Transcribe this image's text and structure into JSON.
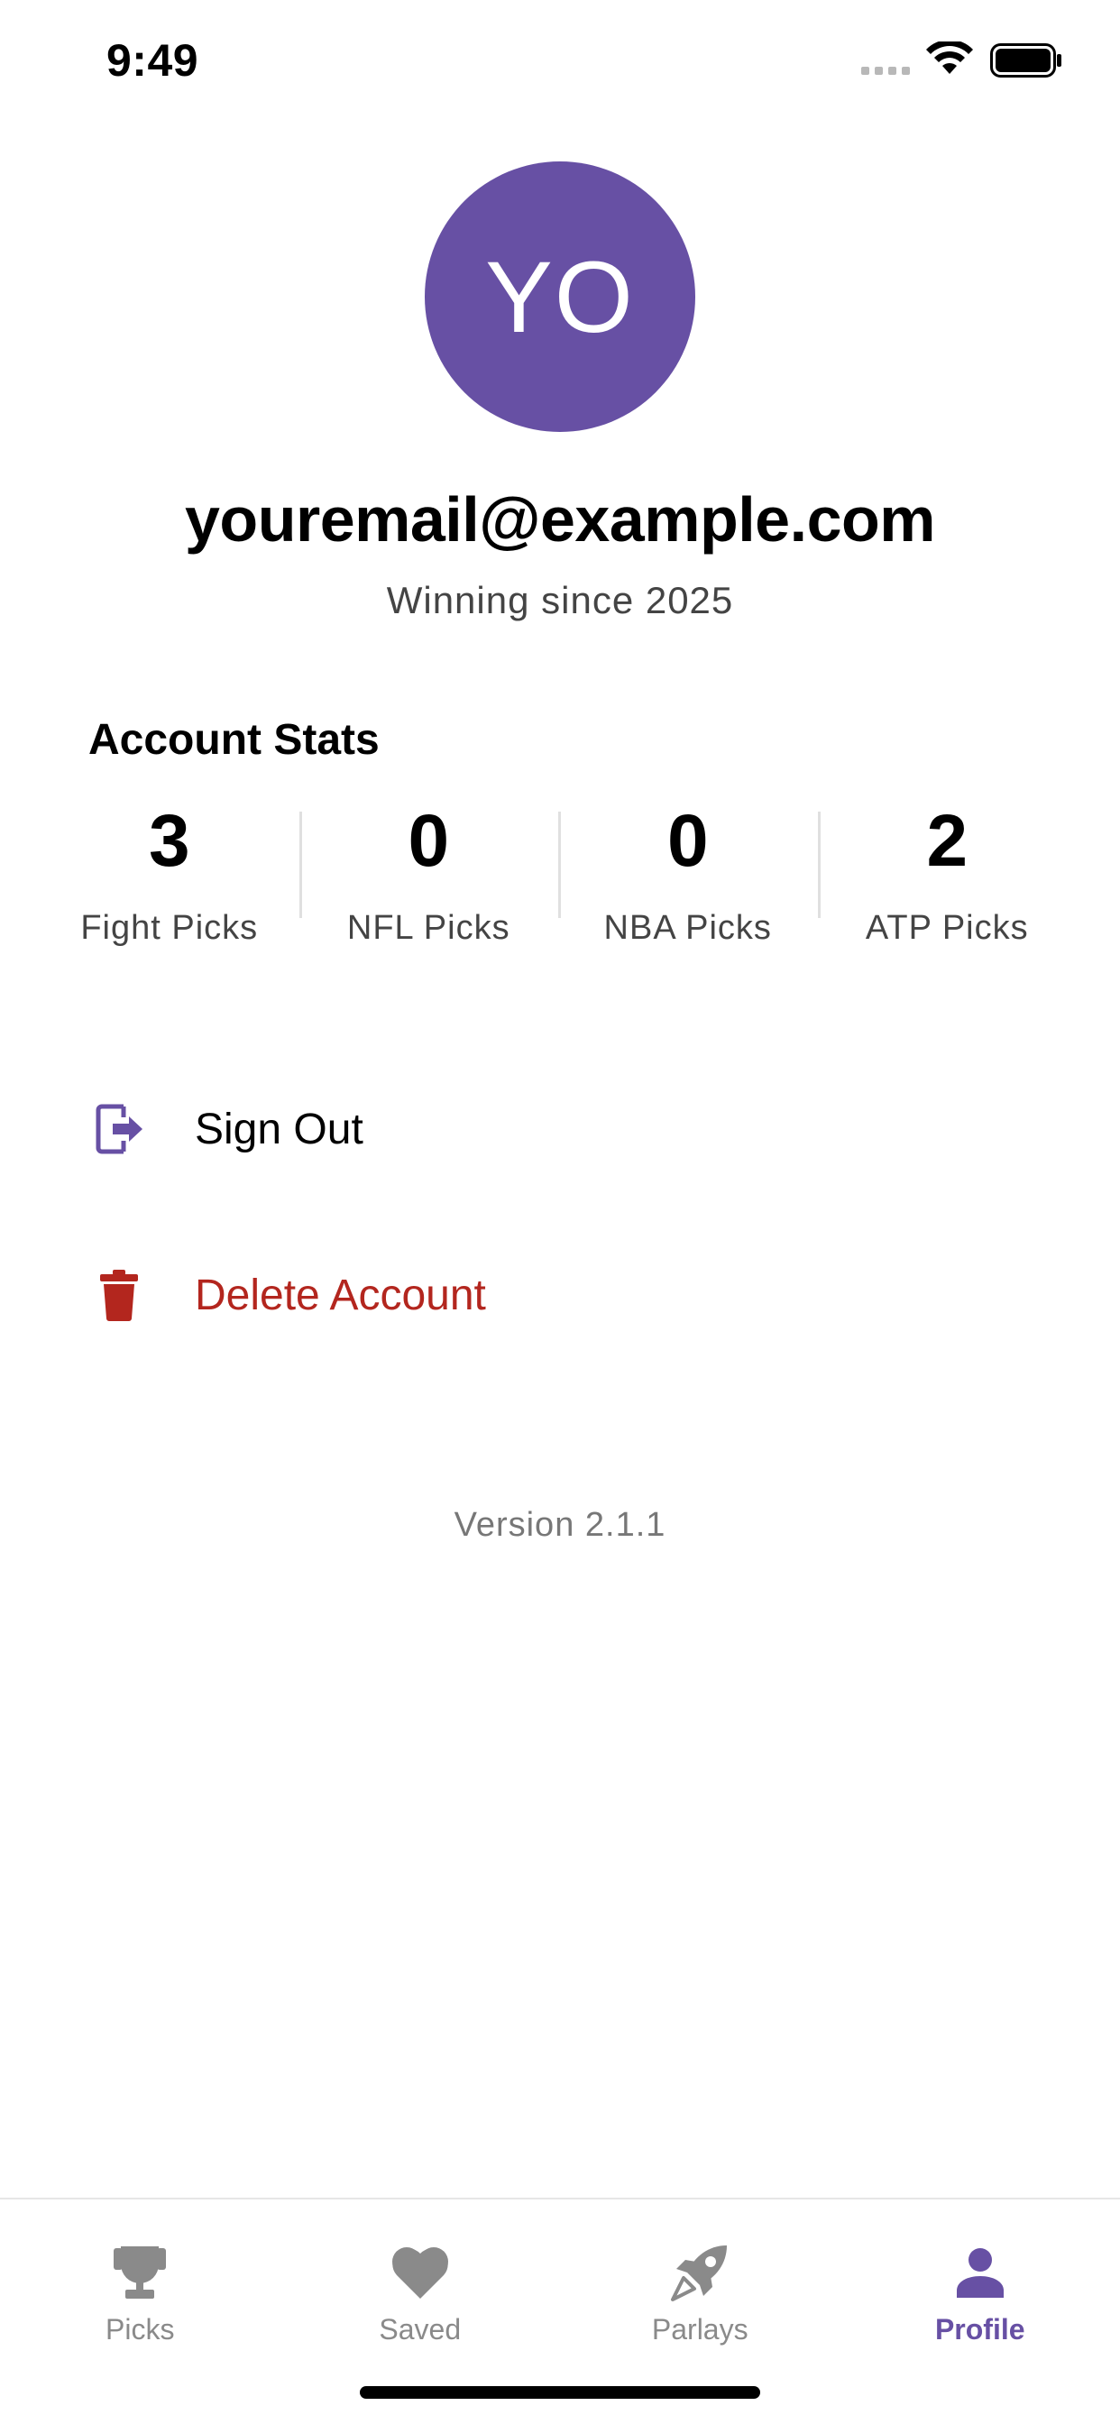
{
  "status_bar": {
    "time": "9:49"
  },
  "profile": {
    "initials": "YO",
    "email": "youremail@example.com",
    "subtitle": "Winning since 2025",
    "avatar_color": "#6750a4"
  },
  "stats": {
    "title": "Account Stats",
    "items": [
      {
        "value": "3",
        "label": "Fight Picks"
      },
      {
        "value": "0",
        "label": "NFL Picks"
      },
      {
        "value": "0",
        "label": "NBA Picks"
      },
      {
        "value": "2",
        "label": "ATP Picks"
      }
    ]
  },
  "menu": {
    "sign_out": {
      "label": "Sign Out",
      "icon": "logout-icon"
    },
    "delete_account": {
      "label": "Delete Account",
      "icon": "trash-icon",
      "color": "#b3261e"
    }
  },
  "version": "Version 2.1.1",
  "tabs": [
    {
      "label": "Picks",
      "icon": "trophy-icon",
      "active": false
    },
    {
      "label": "Saved",
      "icon": "heart-icon",
      "active": false
    },
    {
      "label": "Parlays",
      "icon": "rocket-icon",
      "active": false
    },
    {
      "label": "Profile",
      "icon": "person-icon",
      "active": true
    }
  ],
  "colors": {
    "accent": "#6750a4",
    "danger": "#b3261e",
    "inactive_tab": "#8a8a8a"
  }
}
